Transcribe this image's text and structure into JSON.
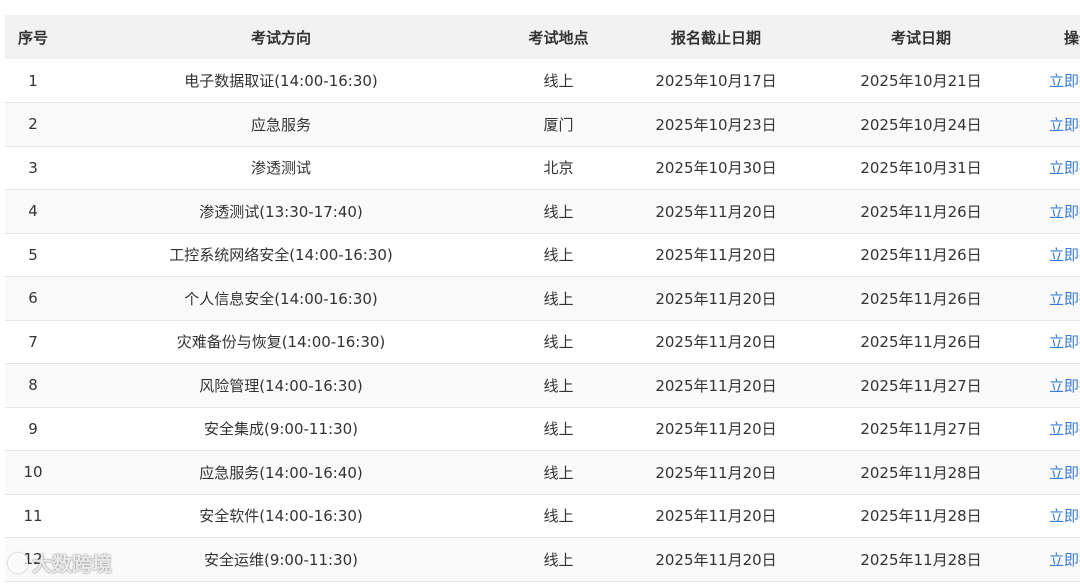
{
  "table": {
    "headers": [
      "序号",
      "考试方向",
      "考试地点",
      "报名截止日期",
      "考试日期",
      "操作"
    ],
    "rows": [
      {
        "no": "1",
        "direction": "电子数据取证(14:00-16:30)",
        "location": "线上",
        "deadline": "2025年10月17日",
        "exam_date": "2025年10月21日",
        "action": "立即报名"
      },
      {
        "no": "2",
        "direction": "应急服务",
        "location": "厦门",
        "deadline": "2025年10月23日",
        "exam_date": "2025年10月24日",
        "action": "立即报名"
      },
      {
        "no": "3",
        "direction": "渗透测试",
        "location": "北京",
        "deadline": "2025年10月30日",
        "exam_date": "2025年10月31日",
        "action": "立即报名"
      },
      {
        "no": "4",
        "direction": "渗透测试(13:30-17:40)",
        "location": "线上",
        "deadline": "2025年11月20日",
        "exam_date": "2025年11月26日",
        "action": "立即报名"
      },
      {
        "no": "5",
        "direction": "工控系统网络安全(14:00-16:30)",
        "location": "线上",
        "deadline": "2025年11月20日",
        "exam_date": "2025年11月26日",
        "action": "立即报名"
      },
      {
        "no": "6",
        "direction": "个人信息安全(14:00-16:30)",
        "location": "线上",
        "deadline": "2025年11月20日",
        "exam_date": "2025年11月26日",
        "action": "立即报名"
      },
      {
        "no": "7",
        "direction": "灾难备份与恢复(14:00-16:30)",
        "location": "线上",
        "deadline": "2025年11月20日",
        "exam_date": "2025年11月26日",
        "action": "立即报名"
      },
      {
        "no": "8",
        "direction": "风险管理(14:00-16:30)",
        "location": "线上",
        "deadline": "2025年11月20日",
        "exam_date": "2025年11月27日",
        "action": "立即报名"
      },
      {
        "no": "9",
        "direction": "安全集成(9:00-11:30)",
        "location": "线上",
        "deadline": "2025年11月20日",
        "exam_date": "2025年11月27日",
        "action": "立即报名"
      },
      {
        "no": "10",
        "direction": "应急服务(14:00-16:40)",
        "location": "线上",
        "deadline": "2025年11月20日",
        "exam_date": "2025年11月28日",
        "action": "立即报名"
      },
      {
        "no": "11",
        "direction": "安全软件(14:00-16:30)",
        "location": "线上",
        "deadline": "2025年11月20日",
        "exam_date": "2025年11月28日",
        "action": "立即报名"
      },
      {
        "no": "12",
        "direction": "安全运维(9:00-11:30)",
        "location": "线上",
        "deadline": "2025年11月20日",
        "exam_date": "2025年11月28日",
        "action": "立即报名"
      }
    ]
  },
  "watermark": {
    "text": "大数跨境",
    "icon": "brand-logo-icon"
  },
  "colors": {
    "link": "#3a7bd5",
    "header_bg": "#f2f2f2",
    "stripe_bg": "#fafafa",
    "border": "#e6e6e6",
    "text": "#333333"
  }
}
